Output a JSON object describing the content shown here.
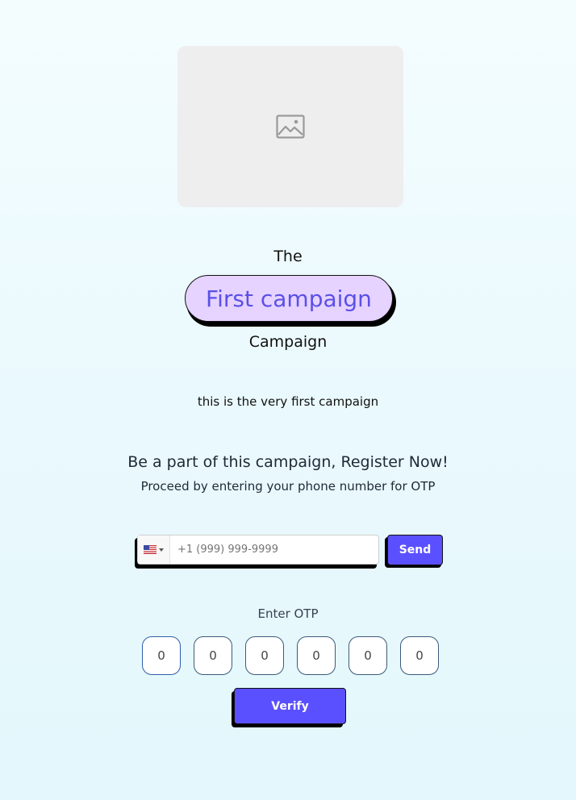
{
  "hero": {
    "image_icon": "image-placeholder-icon",
    "prefix": "The",
    "campaign_name": "First campaign",
    "suffix": "Campaign",
    "description": "this is the very first campaign"
  },
  "register": {
    "title": "Be a part of this campaign, Register Now!",
    "subtitle": "Proceed by entering your phone number for OTP"
  },
  "phone": {
    "country_flag_icon": "us-flag-icon",
    "placeholder": "+1 (999) 999-9999",
    "send_label": "Send"
  },
  "otp": {
    "label": "Enter OTP",
    "digits": [
      "0",
      "0",
      "0",
      "0",
      "0",
      "0"
    ],
    "verify_label": "Verify"
  },
  "colors": {
    "accent": "#5b50ff",
    "pill_bg": "#e6d3ff",
    "pill_text": "#5b50e6"
  }
}
